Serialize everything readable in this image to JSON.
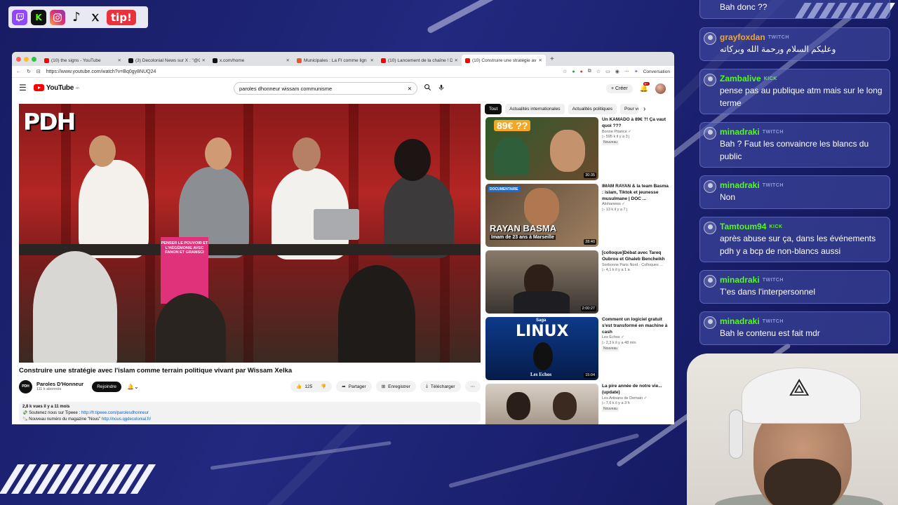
{
  "social": {
    "icons": [
      "twitch-icon",
      "kick-icon",
      "instagram-icon",
      "tiktok-icon",
      "x-icon"
    ],
    "kick_glyph": "K",
    "tip_label": "tip!"
  },
  "browser": {
    "tabs": [
      {
        "title": "(10) the signs - YouTube",
        "active": false,
        "color": "#ff0000"
      },
      {
        "title": "(3) Decolonial News sur X : \"@Gl",
        "active": false,
        "color": "#111111"
      },
      {
        "title": "x.com/home",
        "active": false,
        "color": "#111111"
      },
      {
        "title": "Municipales : La FI comme lign",
        "active": false,
        "color": "#e05a2b"
      },
      {
        "title": "(10) Lancement de la chaîne ! D",
        "active": false,
        "color": "#ff0000"
      },
      {
        "title": "(10) Construire une stratégie av",
        "active": true,
        "color": "#ff0000"
      }
    ],
    "url": "https://www.youtube.com/watch?v=Bq0gy8NUQ24",
    "conversation_label": "Conversation"
  },
  "youtube": {
    "logo_text": "YouTube",
    "logo_country": "FR",
    "search_query": "paroles dhonneur wissam communisme",
    "create_label": "Créer",
    "notif_badge": "9+",
    "video": {
      "overlay_logo": "PDH",
      "poster_text": "PENSER LE POUVOIR ET L'HÉGÉMONIE AVEC FANON ET GRAMSCI",
      "title": "Construire une stratégie avec l'islam comme terrain politique vivant par Wissam Xelka",
      "channel_name": "Paroles D'Honneur",
      "channel_avatar": "PDH",
      "subscribers": "111 k abonnés",
      "join_label": "Rejoindre",
      "likes": "125",
      "share_label": "Partager",
      "save_label": "Enregistrer",
      "download_label": "Télécharger",
      "views_meta": "2,8 k vues  il y a 11 mois",
      "desc_line1_prefix": "💸 Soutenez nous sur Tipeee : ",
      "desc_line1_link": "http://fr.tipeee.com/parolesdhonneur",
      "desc_line2_prefix": "🗞️ Nouveau numéro du magazine \"Nous\" ",
      "desc_line2_link": "http://nous.qgdecolonial.fr/"
    },
    "chips": [
      "Tout",
      "Actualités internationales",
      "Actualités politiques",
      "Pour vo"
    ],
    "recommendations": [
      {
        "title": "Un KAMADO à 89€ ?! Ça vaut quoi ???",
        "channel": "Bonne Pitance ✓",
        "meta": "▷ 595 k  il y a 3 j",
        "badge": "Nouveau",
        "duration": "30:35",
        "thumb_text": "89€ ??",
        "thumb_bg": "linear-gradient(135deg,#2d5a2a,#6b4a2f)"
      },
      {
        "title": "IMAM RAYAN & la team Basma : islam, Tiktok et jeunesse musulmane | DOC ...",
        "channel": "Alohanews ✓",
        "meta": "▷ 13 k  il y a 7 j",
        "badge": "",
        "duration": "28:40",
        "thumb_text": "RAYAN BASMA",
        "thumb_sub": "Imam de 23 ans à Marseille",
        "thumb_tag": "DOCUMENTAIRE",
        "thumb_bg": "linear-gradient(135deg,#5a4a3a,#a08060)"
      },
      {
        "title": "[colloque]Débat avec Tareq Oubrou et Ghaleb Bencheikh",
        "channel": "Sorbonne Paris Nord - Colloques ...",
        "meta": "▷ 4,1 k  il y a 1 a",
        "badge": "",
        "duration": "2:00:27",
        "thumb_bg": "linear-gradient(180deg,#8a7b6a,#3a3430)"
      },
      {
        "title": "Comment un logiciel gratuit s'est transformé en machine à cash",
        "channel": "Les Echos ✓",
        "meta": "▷ 2,3 k  il y a 48 min",
        "badge": "Nouveau",
        "duration": "15:04",
        "thumb_text": "LINUX",
        "thumb_tag": "Saga",
        "thumb_sub": "Les Echos",
        "thumb_bg": "linear-gradient(180deg,#0d3a8a,#061c4a)"
      },
      {
        "title": "La pire année de notre vie... (update)",
        "channel": "Les Artisans de Demain ✓",
        "meta": "▷ 7,6 k  il y a 3 h",
        "badge": "Nouveau",
        "duration": "",
        "thumb_bg": "linear-gradient(180deg,#d8cfc5,#8a7a6a)"
      }
    ]
  },
  "chat": [
    {
      "user": "",
      "platform": "",
      "text": "Bah donc ??"
    },
    {
      "user": "grayfoxdan",
      "platform": "TWITCH",
      "text": "وعليكم السلام ورحمة الله وبركاته"
    },
    {
      "user": "Zambalive",
      "platform": "KICK",
      "text": "pense pas au publique atm mais sur le long terme"
    },
    {
      "user": "minadraki",
      "platform": "TWITCH",
      "text": "Bah ? Faut les convaincre les blancs du public"
    },
    {
      "user": "minadraki",
      "platform": "TWITCH",
      "text": "Non"
    },
    {
      "user": "Tamtoum94",
      "platform": "KICK",
      "text": "après abuse sur ça, dans les événements pdh y a bcp de non-blancs aussi"
    },
    {
      "user": "minadraki",
      "platform": "TWITCH",
      "text": "T'es dans l'interpersonnel"
    },
    {
      "user": "minadraki",
      "platform": "TWITCH",
      "text": "Bah le contenu est fait mdr"
    }
  ]
}
